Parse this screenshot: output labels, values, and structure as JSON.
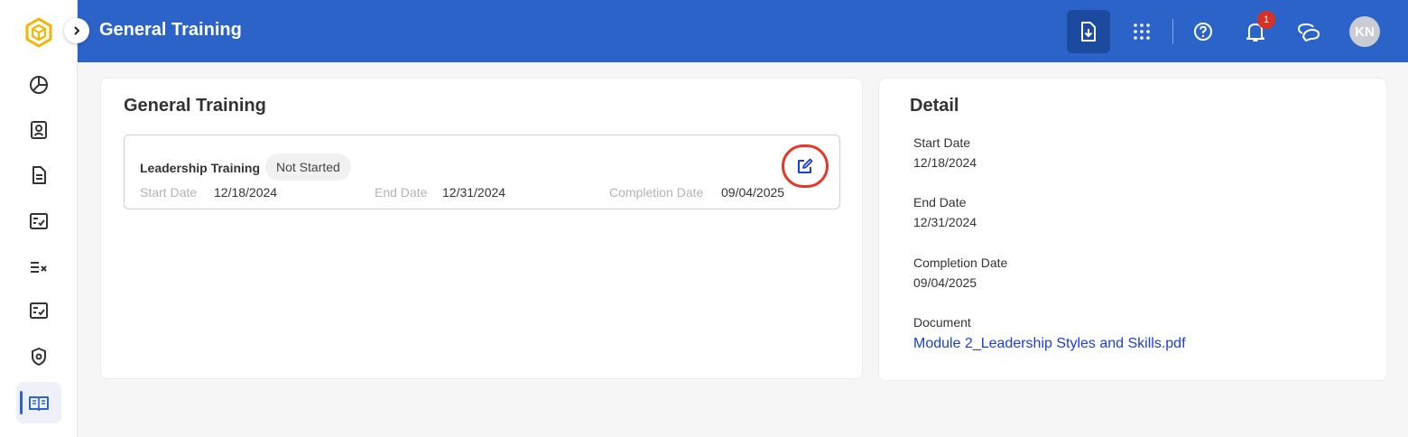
{
  "header": {
    "title": "General Training",
    "notification_count": "1",
    "avatar_initials": "KN"
  },
  "main": {
    "title": "General Training",
    "trainings": [
      {
        "name": "Leadership Training",
        "status": "Not Started",
        "start_label": "Start Date",
        "start_value": "12/18/2024",
        "end_label": "End Date",
        "end_value": "12/31/2024",
        "completion_label": "Completion Date",
        "completion_value": "09/04/2025"
      }
    ]
  },
  "detail": {
    "title": "Detail",
    "start_label": "Start Date",
    "start_value": "12/18/2024",
    "end_label": "End Date",
    "end_value": "12/31/2024",
    "completion_label": "Completion Date",
    "completion_value": "09/04/2025",
    "document_label": "Document",
    "document_link": "Module 2_Leadership Styles and Skills.pdf"
  },
  "colors": {
    "brand": "#2c63c9",
    "link": "#1a3ed4",
    "highlight": "#e23a2a",
    "badge": "#d93025"
  },
  "icons": {
    "sidebar": [
      "dashboard-pie-icon",
      "profile-card-icon",
      "document-icon",
      "checklist-icon",
      "task-list-icon",
      "review-checklist-icon",
      "security-shield-icon",
      "training-book-icon"
    ],
    "header": [
      "download-document-icon",
      "apps-grid-icon",
      "help-icon",
      "bell-icon",
      "chat-icon"
    ]
  }
}
